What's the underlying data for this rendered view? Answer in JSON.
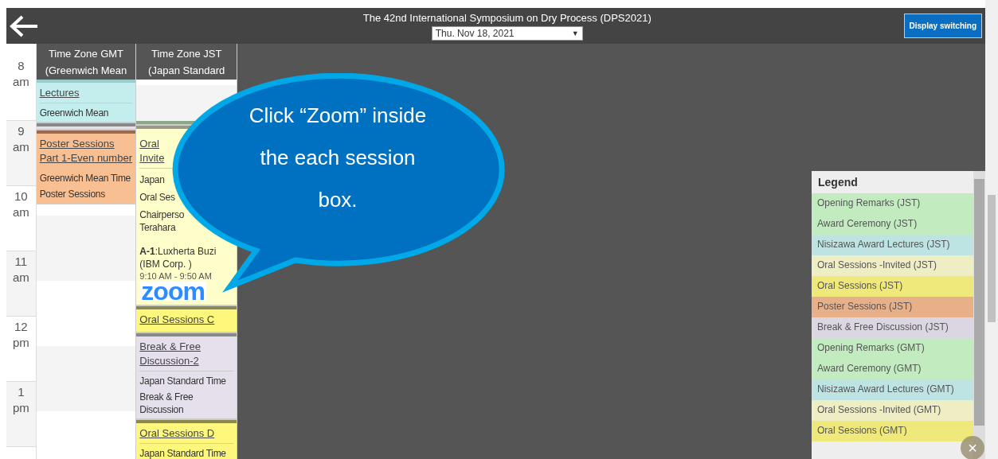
{
  "header": {
    "title": "The 42nd International Symposium on Dry Process (DPS2021)",
    "date_select": {
      "value": "Thu. Nov 18, 2021",
      "caret": "▼"
    },
    "display_button": "Display switching"
  },
  "time_labels": [
    {
      "hour": "8",
      "period": "am"
    },
    {
      "hour": "9",
      "period": "am"
    },
    {
      "hour": "10",
      "period": "am"
    },
    {
      "hour": "11",
      "period": "am"
    },
    {
      "hour": "12",
      "period": "pm"
    },
    {
      "hour": "1",
      "period": "pm"
    }
  ],
  "columns": [
    {
      "heading": [
        "Time Zone GMT",
        "(Greenwich Mean"
      ],
      "events": [
        {
          "kind": "award",
          "link": [
            "Lectures"
          ],
          "lines": [
            "Greenwich Mean"
          ]
        },
        {
          "kind": "break"
        },
        {
          "kind": "poster",
          "link": [
            "Poster Sessions",
            "Part 1-Even number"
          ],
          "lines": [
            "Greenwich Mean Time",
            "Poster Sessions"
          ]
        }
      ]
    },
    {
      "heading": [
        "Time Zone JST",
        "(Japan Standard"
      ],
      "events": [
        {
          "kind": "opening"
        },
        {
          "kind": "invited",
          "link": [
            "Oral",
            "Invite"
          ],
          "lines": [
            "Japan",
            "Oral Ses"
          ],
          "note": [
            "Chairperso",
            "Terahara"
          ],
          "talk": {
            "code": "A-1",
            "speaker": ":Luxherta Buzi (IBM Corp. )",
            "time": "9:10 AM - 9:50 AM"
          },
          "zoom": "zoom"
        },
        {
          "kind": "oral",
          "link": [
            "Oral Sessions C"
          ]
        },
        {
          "kind": "break",
          "link": [
            "Break & Free",
            "Discussion-2"
          ],
          "lines": [
            "Japan Standard Time",
            "Break & Free Discussion"
          ]
        },
        {
          "kind": "oral",
          "link": [
            "Oral Sessions D"
          ],
          "lines": [
            "Japan Standard Time"
          ]
        }
      ]
    }
  ],
  "callout": "Click “Zoom” inside the each session box.",
  "legend": {
    "title": "Legend",
    "items": [
      {
        "label": "Opening Remarks (JST)",
        "color": "#c2ecc0"
      },
      {
        "label": "Award Ceremony (JST)",
        "color": "#c2ecc0"
      },
      {
        "label": "Nisizawa Award Lectures (JST)",
        "color": "#bde3e3"
      },
      {
        "label": "Oral Sessions -Invited (JST)",
        "color": "#efedc4"
      },
      {
        "label": "Oral Sessions (JST)",
        "color": "#efe87a"
      },
      {
        "label": "Poster Sessions (JST)",
        "color": "#e8b088"
      },
      {
        "label": "Break & Free Discussion (JST)",
        "color": "#dcd6e3"
      },
      {
        "label": "Opening Remarks (GMT)",
        "color": "#c2ecc0"
      },
      {
        "label": "Award Ceremony (GMT)",
        "color": "#c2ecc0"
      },
      {
        "label": "Nisizawa Award Lectures (GMT)",
        "color": "#bde3e3"
      },
      {
        "label": "Oral Sessions -Invited (GMT)",
        "color": "#efedc4"
      },
      {
        "label": "Oral Sessions (GMT)",
        "color": "#efe87a"
      }
    ],
    "close": "×"
  }
}
